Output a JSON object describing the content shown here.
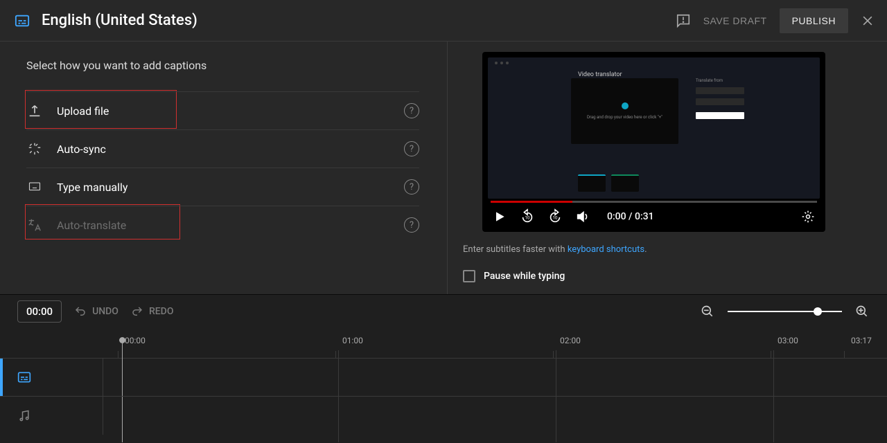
{
  "header": {
    "title": "English (United States)",
    "save_draft": "SAVE DRAFT",
    "publish": "PUBLISH"
  },
  "left": {
    "instruction": "Select how you want to add captions",
    "options": {
      "upload": "Upload file",
      "autosync": "Auto-sync",
      "type": "Type manually",
      "translate": "Auto-translate"
    }
  },
  "video": {
    "thumb_title": "Video translator",
    "thumb_drop": "Drag and drop your video here or click \"+\"",
    "thumb_from": "Translate from",
    "current": "0:00",
    "duration": "0:31",
    "time_display": "0:00 / 0:31"
  },
  "hint": {
    "prefix": "Enter subtitles faster with ",
    "link": "keyboard shortcuts",
    "suffix": "."
  },
  "pause_label": "Pause while typing",
  "toolbar": {
    "time": "00:00",
    "undo": "UNDO",
    "redo": "REDO"
  },
  "ruler": {
    "t0": "00:00",
    "t1": "01:00",
    "t2": "02:00",
    "t3": "03:00",
    "tend": "03:17"
  }
}
